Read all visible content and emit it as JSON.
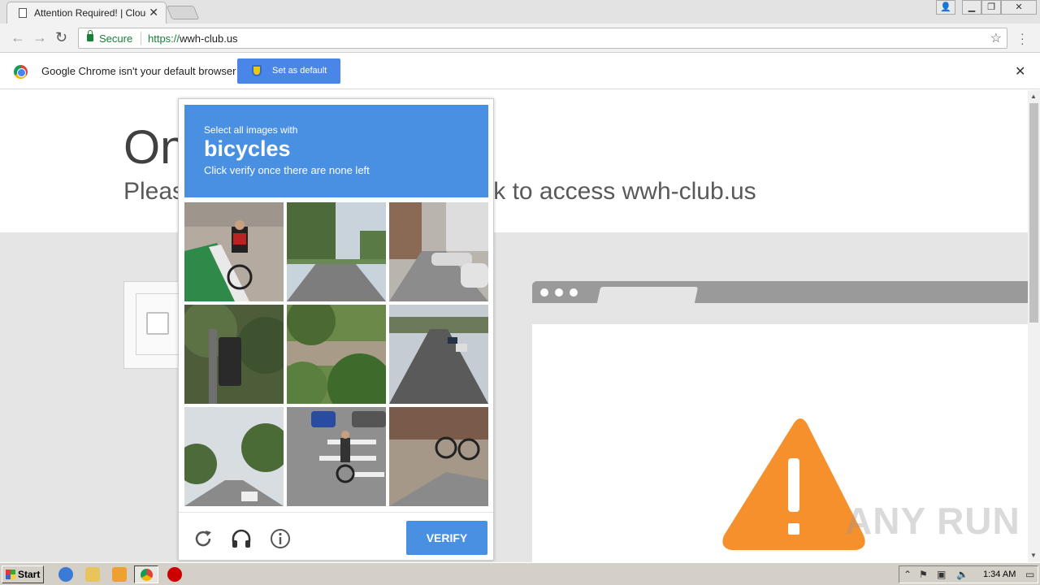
{
  "browser": {
    "tab_title": "Attention Required! | Cloudfl",
    "url_scheme": "https://",
    "url_host": "wwh-club.us",
    "secure_label": "Secure"
  },
  "infobar": {
    "message": "Google Chrome isn't your default browser",
    "button_label": "Set as default"
  },
  "page": {
    "heading": "One more step",
    "subheading": "Please complete the security check to access wwh-club.us"
  },
  "captcha": {
    "instruction": "Select all images with",
    "target": "bicycles",
    "hint": "Click verify once there are none left",
    "verify_label": "VERIFY",
    "tiles": [
      {
        "scene": "cyclist-bike-lane"
      },
      {
        "scene": "tree-lined-road"
      },
      {
        "scene": "parked-cars-alley"
      },
      {
        "scene": "traffic-light-trees"
      },
      {
        "scene": "palm-foliage"
      },
      {
        "scene": "highway-cars"
      },
      {
        "scene": "residential-street"
      },
      {
        "scene": "cyclist-crosswalk"
      },
      {
        "scene": "parked-bicycle-sidewalk"
      }
    ]
  },
  "watermark": "ANY RUN",
  "taskbar": {
    "start_label": "Start",
    "clock": "1:34 AM"
  },
  "colors": {
    "captcha_blue": "#4a90e2",
    "infobar_button": "#4a86e8",
    "secure_green": "#188038",
    "warning_orange": "#f6902d"
  }
}
